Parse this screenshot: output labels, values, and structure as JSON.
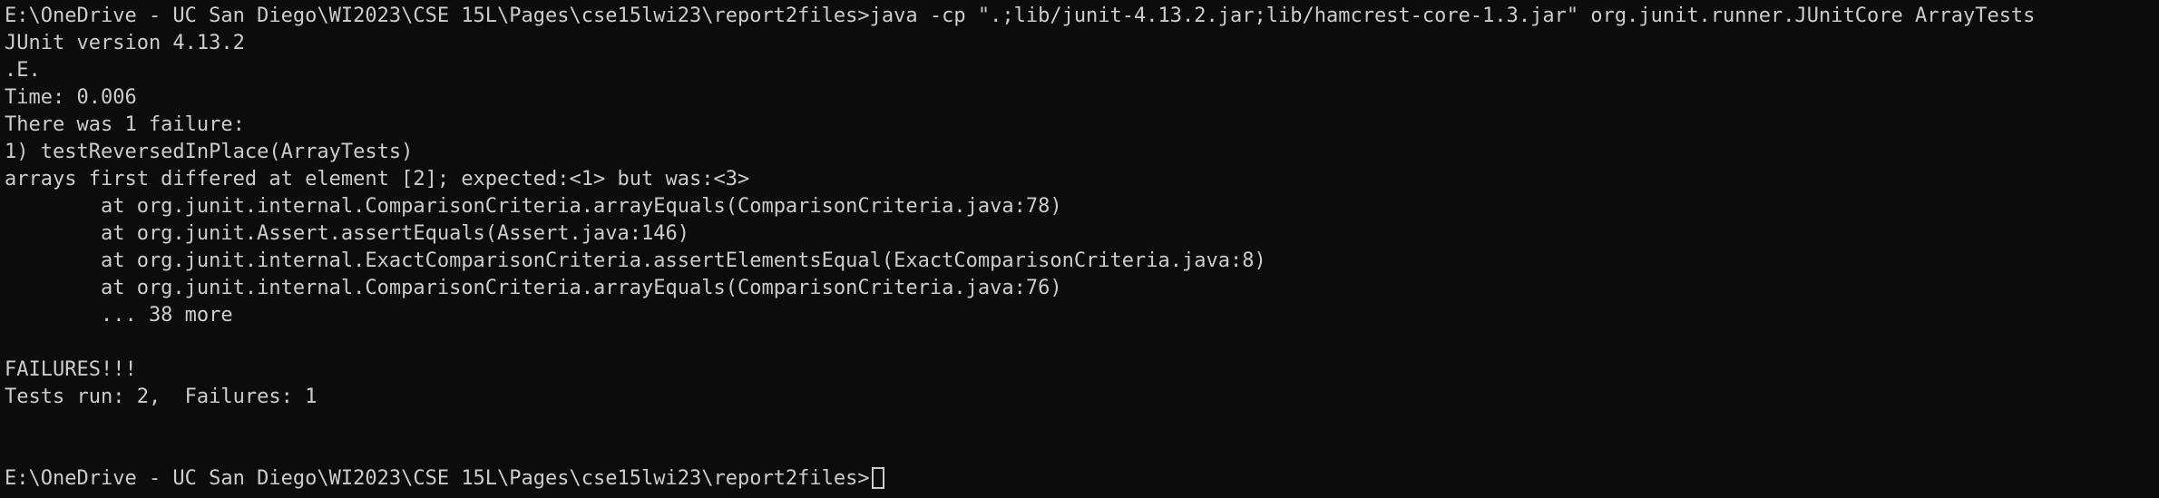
{
  "terminal": {
    "lines": [
      "E:\\OneDrive - UC San Diego\\WI2023\\CSE 15L\\Pages\\cse15lwi23\\report2files>java -cp \".;lib/junit-4.13.2.jar;lib/hamcrest-core-1.3.jar\" org.junit.runner.JUnitCore ArrayTests",
      "JUnit version 4.13.2",
      ".E.",
      "Time: 0.006",
      "There was 1 failure:",
      "1) testReversedInPlace(ArrayTests)",
      "arrays first differed at element [2]; expected:<1> but was:<3>",
      "        at org.junit.internal.ComparisonCriteria.arrayEquals(ComparisonCriteria.java:78)",
      "        at org.junit.Assert.assertEquals(Assert.java:146)",
      "        at org.junit.internal.ExactComparisonCriteria.assertElementsEqual(ExactComparisonCriteria.java:8)",
      "        at org.junit.internal.ComparisonCriteria.arrayEquals(ComparisonCriteria.java:76)",
      "        ... 38 more",
      "",
      "FAILURES!!!",
      "Tests run: 2,  Failures: 1",
      "",
      ""
    ],
    "prompt": "E:\\OneDrive - UC San Diego\\WI2023\\CSE 15L\\Pages\\cse15lwi23\\report2files>"
  },
  "colors": {
    "background": "#0c0c0c",
    "foreground": "#cccccc"
  }
}
